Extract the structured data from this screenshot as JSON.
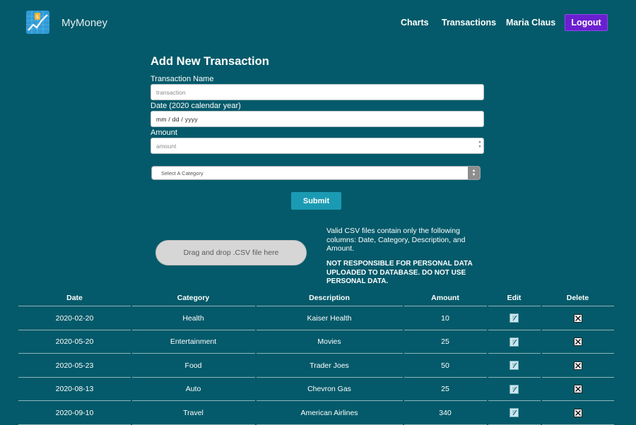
{
  "nav": {
    "brand": "MyMoney",
    "logo_icon": "money-chart-logo-icon",
    "links": [
      "Charts",
      "Transactions",
      "Maria Claus"
    ],
    "logout_label": "Logout"
  },
  "form": {
    "title": "Add New Transaction",
    "name_label": "Transaction Name",
    "name_placeholder": "transaction",
    "date_label": "Date (2020 calendar year)",
    "date_placeholder": "mm / dd / yyyy",
    "amount_label": "Amount",
    "amount_placeholder": "amount",
    "category_selected": "Select A Category",
    "submit_label": "Submit"
  },
  "upload": {
    "dropzone_label": "Drag and drop .CSV file here",
    "info": "Valid CSV files contain only the following columns: Date, Category, Description, and Amount.",
    "warning": "NOT RESPONSIBLE FOR PERSONAL DATA UPLOADED TO DATABASE. DO NOT USE PERSONAL DATA."
  },
  "table": {
    "headers": [
      "Date",
      "Category",
      "Description",
      "Amount",
      "Edit",
      "Delete"
    ],
    "rows": [
      {
        "date": "2020-02-20",
        "category": "Health",
        "description": "Kaiser Health",
        "amount": "10"
      },
      {
        "date": "2020-05-20",
        "category": "Entertainment",
        "description": "Movies",
        "amount": "25"
      },
      {
        "date": "2020-05-23",
        "category": "Food",
        "description": "Trader Joes",
        "amount": "50"
      },
      {
        "date": "2020-08-13",
        "category": "Auto",
        "description": "Chevron Gas",
        "amount": "25"
      },
      {
        "date": "2020-09-10",
        "category": "Travel",
        "description": "American Airlines",
        "amount": "340"
      }
    ],
    "edit_icon": "edit-icon",
    "delete_icon": "delete-x-icon"
  },
  "colors": {
    "background": "#045a6a",
    "logout": "#6a1fd0",
    "submit": "#1b9ab3"
  }
}
